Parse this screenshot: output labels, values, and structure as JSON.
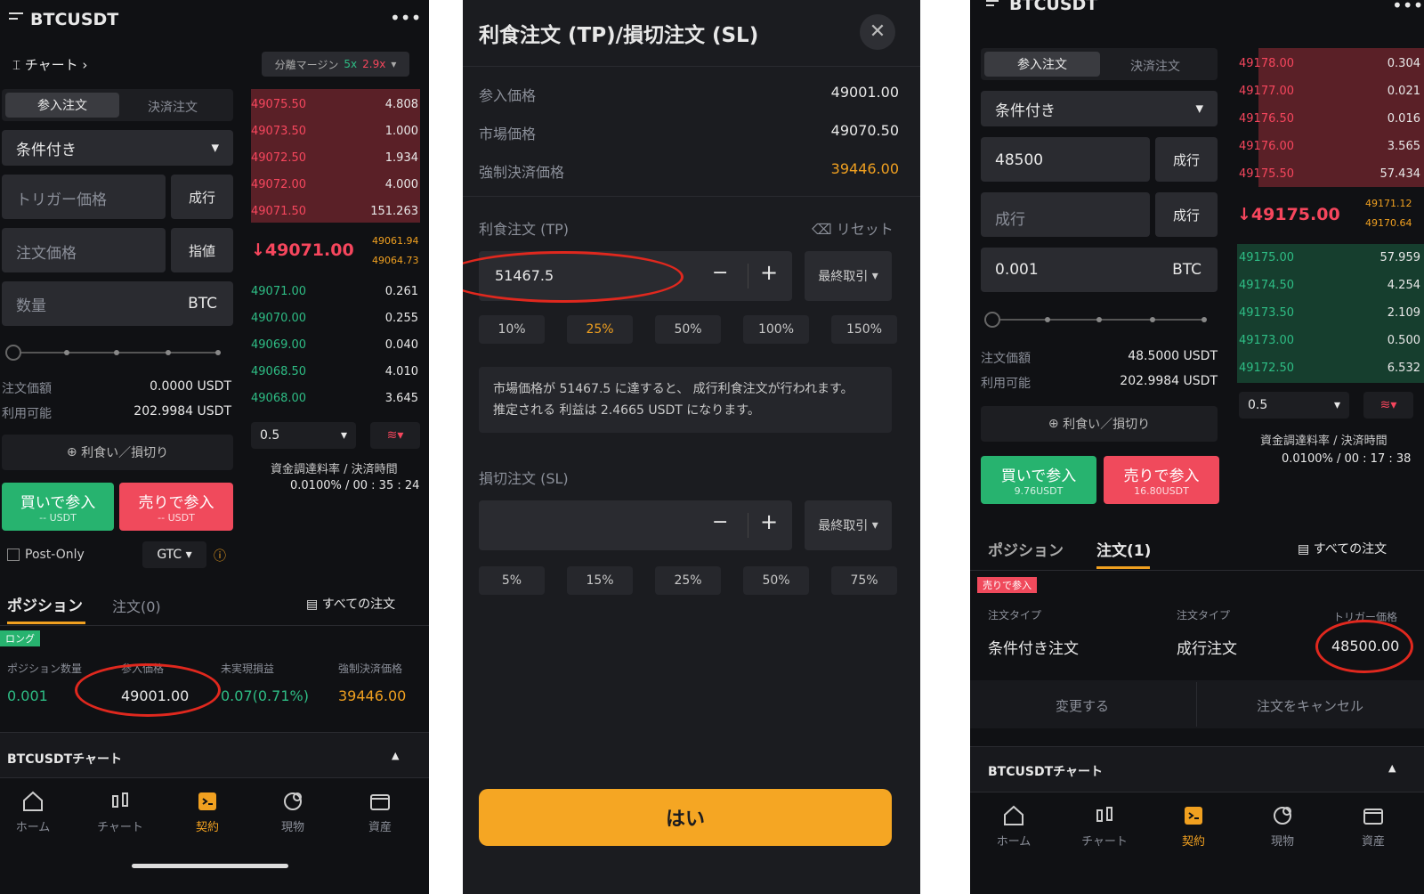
{
  "left": {
    "symbol": "BTCUSDT",
    "chart_link": "チャート",
    "margin": "分離マージン",
    "lev1": "5x",
    "lev2": "2.9x",
    "tab_open": "参入注文",
    "tab_close": "決済注文",
    "order_type": "条件付き",
    "trigger_ph": "トリガー価格",
    "trigger_mode": "成行",
    "price_ph": "注文価格",
    "price_mode": "指値",
    "qty_ph": "数量",
    "qty_unit": "BTC",
    "amount_label": "注文価額",
    "amount_val": "0.0000 USDT",
    "avail_label": "利用可能",
    "avail_val": "202.9984 USDT",
    "tpsl": "利食い／損切り",
    "buy": "買いで参入",
    "buy_sub": "-- USDT",
    "sell": "売りで参入",
    "sell_sub": "-- USDT",
    "postonly": "Post-Only",
    "gtc": "GTC",
    "asks": [
      [
        "49075.50",
        "4.808"
      ],
      [
        "49073.50",
        "1.000"
      ],
      [
        "49072.50",
        "1.934"
      ],
      [
        "49072.00",
        "4.000"
      ],
      [
        "49071.50",
        "151.263"
      ]
    ],
    "last": "↓49071.00",
    "mark1": "49061.94",
    "mark2": "49064.73",
    "bids": [
      [
        "49071.00",
        "0.261"
      ],
      [
        "49070.00",
        "0.255"
      ],
      [
        "49069.00",
        "0.040"
      ],
      [
        "49068.50",
        "4.010"
      ],
      [
        "49068.00",
        "3.645"
      ]
    ],
    "depth": "0.5",
    "funding_label": "資金調達料率 / 決済時間",
    "funding_val": "0.0100% / 00 : 35 : 24",
    "tab_pos": "ポジション",
    "tab_orders": "注文(0)",
    "all_orders": "すべての注文",
    "long": "ロング",
    "h_qty": "ポジション数量",
    "h_entry": "参入価格",
    "h_pnl": "未実現損益",
    "h_liq": "強制決済価格",
    "v_qty": "0.001",
    "v_entry": "49001.00",
    "v_pnl": "0.07(0.71%)",
    "v_liq": "39446.00",
    "chart_bar": "BTCUSDTチャート"
  },
  "nav": {
    "home": "ホーム",
    "chart": "チャート",
    "contract": "契約",
    "spot": "現物",
    "assets": "資産"
  },
  "mid": {
    "title": "利食注文 (TP)/損切注文 (SL)",
    "entry_label": "参入価格",
    "entry_val": "49001.00",
    "market_label": "市場価格",
    "market_val": "49070.50",
    "liq_label": "強制決済価格",
    "liq_val": "39446.00",
    "tp_label": "利食注文 (TP)",
    "reset": "リセット",
    "tp_val": "51467.5",
    "last_trade": "最終取引",
    "tp_pcts": [
      "10%",
      "25%",
      "50%",
      "100%",
      "150%"
    ],
    "note1": "市場価格が 51467.5 に達すると、 成行利食注文が行われます。",
    "note2": "推定される 利益は 2.4665 USDT になります。",
    "sl_label": "損切注文 (SL)",
    "sl_pcts": [
      "5%",
      "15%",
      "25%",
      "50%",
      "75%"
    ],
    "confirm": "はい"
  },
  "right": {
    "symbol": "BTCUSDT",
    "tab_open": "参入注文",
    "tab_close": "決済注文",
    "order_type": "条件付き",
    "trigger_val": "48500",
    "trigger_mode": "成行",
    "price_val": "成行",
    "price_mode": "成行",
    "qty_val": "0.001",
    "qty_unit": "BTC",
    "amount_label": "注文価額",
    "amount_val": "48.5000 USDT",
    "avail_label": "利用可能",
    "avail_val": "202.9984 USDT",
    "tpsl": "利食い／損切り",
    "buy": "買いで参入",
    "buy_sub": "9.76USDT",
    "sell": "売りで参入",
    "sell_sub": "16.80USDT",
    "asks": [
      [
        "49178.00",
        "0.304"
      ],
      [
        "49177.00",
        "0.021"
      ],
      [
        "49176.50",
        "0.016"
      ],
      [
        "49176.00",
        "3.565"
      ],
      [
        "49175.50",
        "57.434"
      ]
    ],
    "last": "↓49175.00",
    "mark1": "49171.12",
    "mark2": "49170.64",
    "bids": [
      [
        "49175.00",
        "57.959"
      ],
      [
        "49174.50",
        "4.254"
      ],
      [
        "49173.50",
        "2.109"
      ],
      [
        "49173.00",
        "0.500"
      ],
      [
        "49172.50",
        "6.532"
      ]
    ],
    "depth": "0.5",
    "funding_label": "資金調達料率 / 決済時間",
    "funding_val": "0.0100% / 00 : 17 : 38",
    "tab_pos": "ポジション",
    "tab_orders": "注文(1)",
    "all_orders": "すべての注文",
    "badge": "売りで参入",
    "h_type1": "注文タイプ",
    "h_type2": "注文タイプ",
    "h_trigger": "トリガー価格",
    "v_type1": "条件付き注文",
    "v_type2": "成行注文",
    "v_trigger": "48500.00",
    "modify": "変更する",
    "cancel": "注文をキャンセル",
    "chart_bar": "BTCUSDTチャート"
  }
}
